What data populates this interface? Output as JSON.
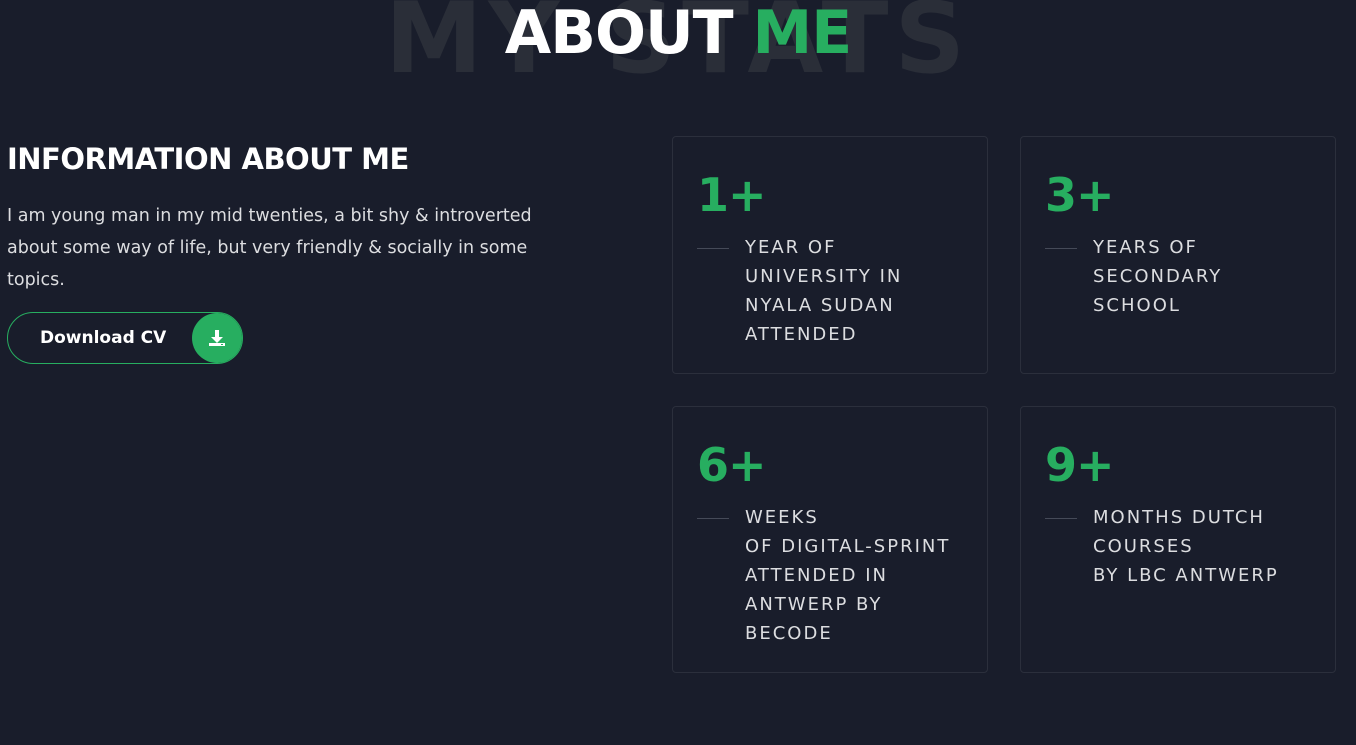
{
  "heading": {
    "background_word": "MY STATS",
    "title_white": "ABOUT",
    "title_green": "ME"
  },
  "info": {
    "title": "INFORMATION ABOUT ME",
    "text": "I am young man in my mid twenties, a bit shy & introverted about some way of life, but very friendly & socially in some topics.",
    "cv_button_label": "Download CV",
    "cv_button_icon": "download-icon"
  },
  "stats": [
    {
      "number": "1+",
      "description": "YEAR OF\nUNIVERSITY IN\nNYALA SUDAN\nATTENDED"
    },
    {
      "number": "3+",
      "description": "YEARS OF\nSECONDARY\nSCHOOL"
    },
    {
      "number": "6+",
      "description": "WEEKS\nOF DIGITAL-SPRINT\nATTENDED IN\nANTWERP BY\nBECODE"
    },
    {
      "number": "9+",
      "description": "MONTHS DUTCH\nCOURSES\nBY LBC ANTWERP"
    }
  ],
  "colors": {
    "background": "#191d2b",
    "accent": "#27ae60",
    "text": "#ffffff",
    "muted_text": "#dcdde0",
    "card_border": "#2b2f3c"
  }
}
